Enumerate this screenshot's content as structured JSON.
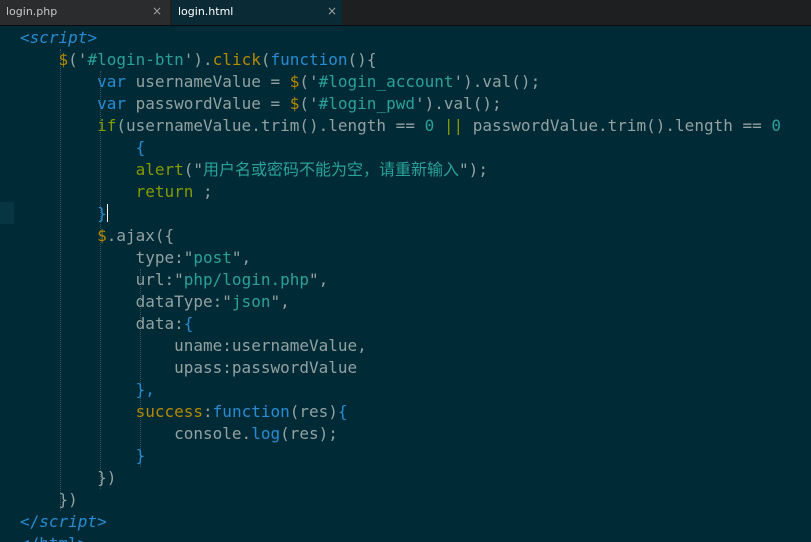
{
  "tabs": [
    {
      "label": "login.php",
      "close_label": "×",
      "active": false
    },
    {
      "label": "login.html",
      "close_label": "×",
      "active": true
    }
  ],
  "colors": {
    "background": "#002b36",
    "tag": "#268bd2",
    "plain": "#93a1a1",
    "jquery": "#b58900",
    "string": "#2aa198",
    "keyword_green": "#859900",
    "function": "#268bd2",
    "comment": "#586e75"
  },
  "code_lines": [
    [
      {
        "t": "<",
        "c": "#268bd2"
      },
      {
        "t": "script",
        "c": "#268bd2",
        "i": true
      },
      {
        "t": ">",
        "c": "#268bd2"
      }
    ],
    [
      {
        "t": "    ",
        "c": "#93a1a1"
      },
      {
        "t": "$",
        "c": "#b58900"
      },
      {
        "t": "('",
        "c": "#93a1a1"
      },
      {
        "t": "#login-btn",
        "c": "#2aa198"
      },
      {
        "t": "').",
        "c": "#93a1a1"
      },
      {
        "t": "click",
        "c": "#b58900"
      },
      {
        "t": "(",
        "c": "#93a1a1"
      },
      {
        "t": "function",
        "c": "#268bd2"
      },
      {
        "t": "(){",
        "c": "#93a1a1"
      }
    ],
    [
      {
        "t": "        ",
        "c": "#93a1a1"
      },
      {
        "t": "var",
        "c": "#268bd2"
      },
      {
        "t": " usernameValue = ",
        "c": "#93a1a1"
      },
      {
        "t": "$",
        "c": "#b58900"
      },
      {
        "t": "('",
        "c": "#93a1a1"
      },
      {
        "t": "#login_account",
        "c": "#2aa198"
      },
      {
        "t": "').val();",
        "c": "#93a1a1"
      }
    ],
    [
      {
        "t": "        ",
        "c": "#93a1a1"
      },
      {
        "t": "var",
        "c": "#268bd2"
      },
      {
        "t": " passwordValue = ",
        "c": "#93a1a1"
      },
      {
        "t": "$",
        "c": "#b58900"
      },
      {
        "t": "('",
        "c": "#93a1a1"
      },
      {
        "t": "#login_pwd",
        "c": "#2aa198"
      },
      {
        "t": "').val();",
        "c": "#93a1a1"
      }
    ],
    [
      {
        "t": "        ",
        "c": "#93a1a1"
      },
      {
        "t": "if",
        "c": "#859900"
      },
      {
        "t": "(usernameValue.trim().length == ",
        "c": "#93a1a1"
      },
      {
        "t": "0",
        "c": "#2aa198"
      },
      {
        "t": " ",
        "c": "#93a1a1"
      },
      {
        "t": "||",
        "c": "#859900"
      },
      {
        "t": " passwordValue.trim().length == ",
        "c": "#93a1a1"
      },
      {
        "t": "0",
        "c": "#2aa198"
      }
    ],
    [
      {
        "t": "            ",
        "c": "#93a1a1"
      },
      {
        "t": "{",
        "c": "#268bd2"
      }
    ],
    [
      {
        "t": "            ",
        "c": "#93a1a1"
      },
      {
        "t": "alert",
        "c": "#859900"
      },
      {
        "t": "(\"",
        "c": "#93a1a1"
      },
      {
        "t": "用户名或密码不能为空，请重新输入",
        "c": "#2aa198"
      },
      {
        "t": "\");",
        "c": "#93a1a1"
      }
    ],
    [
      {
        "t": "            ",
        "c": "#93a1a1"
      },
      {
        "t": "return",
        "c": "#859900"
      },
      {
        "t": " ;",
        "c": "#93a1a1"
      }
    ],
    [
      {
        "t": "        ",
        "c": "#93a1a1"
      },
      {
        "t": "}",
        "c": "#268bd2"
      }
    ],
    [
      {
        "t": "        ",
        "c": "#93a1a1"
      },
      {
        "t": "$",
        "c": "#b58900"
      },
      {
        "t": ".ajax({",
        "c": "#93a1a1"
      }
    ],
    [
      {
        "t": "            type:\"",
        "c": "#93a1a1"
      },
      {
        "t": "post",
        "c": "#2aa198"
      },
      {
        "t": "\",",
        "c": "#93a1a1"
      }
    ],
    [
      {
        "t": "            url:\"",
        "c": "#93a1a1"
      },
      {
        "t": "php/login.php",
        "c": "#2aa198"
      },
      {
        "t": "\",",
        "c": "#93a1a1"
      }
    ],
    [
      {
        "t": "            dataType:\"",
        "c": "#93a1a1"
      },
      {
        "t": "json",
        "c": "#2aa198"
      },
      {
        "t": "\",",
        "c": "#93a1a1"
      }
    ],
    [
      {
        "t": "            data:",
        "c": "#93a1a1"
      },
      {
        "t": "{",
        "c": "#268bd2"
      }
    ],
    [
      {
        "t": "                uname:usernameValue,",
        "c": "#93a1a1"
      }
    ],
    [
      {
        "t": "                upass:passwordValue",
        "c": "#93a1a1"
      }
    ],
    [
      {
        "t": "            ",
        "c": "#93a1a1"
      },
      {
        "t": "},",
        "c": "#268bd2"
      }
    ],
    [
      {
        "t": "            ",
        "c": "#93a1a1"
      },
      {
        "t": "success",
        "c": "#b58900"
      },
      {
        "t": ":",
        "c": "#93a1a1"
      },
      {
        "t": "function",
        "c": "#268bd2"
      },
      {
        "t": "(res)",
        "c": "#93a1a1"
      },
      {
        "t": "{",
        "c": "#268bd2"
      }
    ],
    [
      {
        "t": "                console.",
        "c": "#93a1a1"
      },
      {
        "t": "log",
        "c": "#268bd2"
      },
      {
        "t": "(res);",
        "c": "#93a1a1"
      }
    ],
    [
      {
        "t": "            ",
        "c": "#93a1a1"
      },
      {
        "t": "}",
        "c": "#268bd2"
      }
    ],
    [
      {
        "t": "        })",
        "c": "#93a1a1"
      }
    ],
    [
      {
        "t": "    })",
        "c": "#93a1a1"
      }
    ],
    [
      {
        "t": "</",
        "c": "#268bd2"
      },
      {
        "t": "script",
        "c": "#268bd2",
        "i": true
      },
      {
        "t": ">",
        "c": "#268bd2"
      }
    ],
    [
      {
        "t": "</",
        "c": "#268bd2"
      },
      {
        "t": "html",
        "c": "#268bd2"
      },
      {
        "t": ">",
        "c": "#268bd2"
      }
    ]
  ]
}
